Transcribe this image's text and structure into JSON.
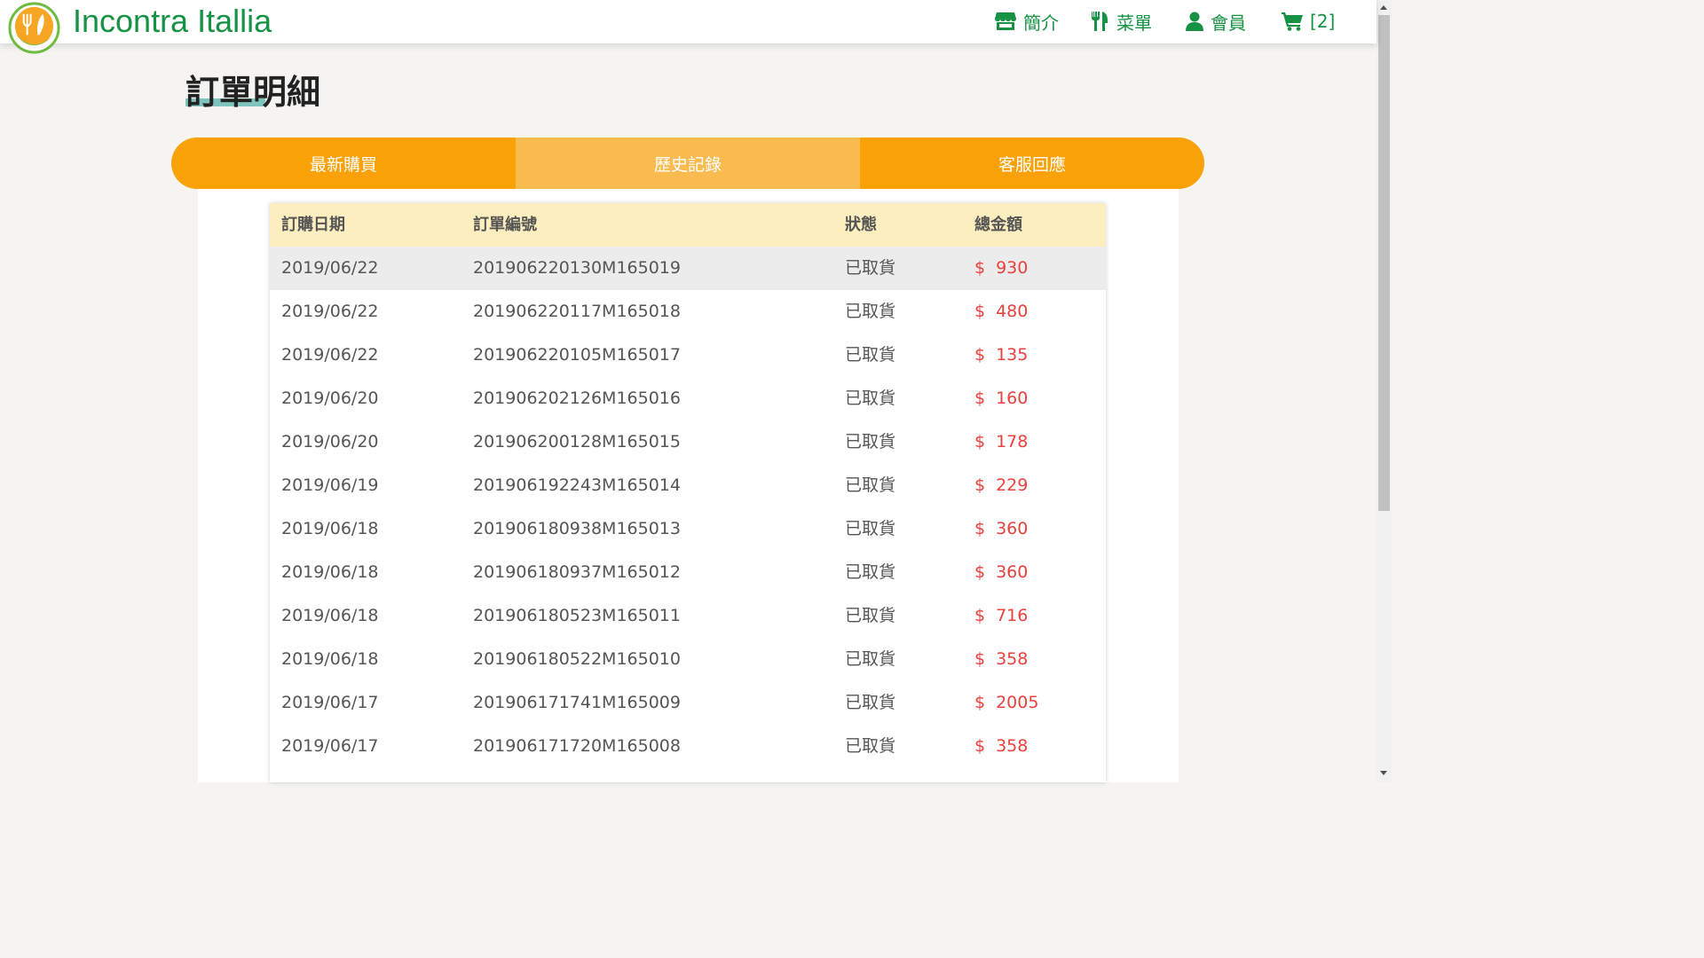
{
  "nav": {
    "brand": "Incontra Itallia",
    "about": "簡介",
    "menu": "菜單",
    "member": "會員",
    "cart": "[2]",
    "icons": [
      "store-icon",
      "utensils-icon",
      "user-icon",
      "cart-icon"
    ],
    "accent_color": "#169245"
  },
  "page": {
    "title": "訂單明細"
  },
  "tabs": [
    {
      "label": "最新購買",
      "active": false
    },
    {
      "label": "歷史記錄",
      "active": true
    },
    {
      "label": "客服回應",
      "active": false
    }
  ],
  "table": {
    "headers": {
      "date": "訂購日期",
      "order_id": "訂單編號",
      "status": "狀態",
      "total": "總金額"
    },
    "currency": "$",
    "rows": [
      {
        "date": "2019/06/22",
        "order_id": "201906220130M165019",
        "status": "已取貨",
        "total": "930"
      },
      {
        "date": "2019/06/22",
        "order_id": "201906220117M165018",
        "status": "已取貨",
        "total": "480"
      },
      {
        "date": "2019/06/22",
        "order_id": "201906220105M165017",
        "status": "已取貨",
        "total": "135"
      },
      {
        "date": "2019/06/20",
        "order_id": "201906202126M165016",
        "status": "已取貨",
        "total": "160"
      },
      {
        "date": "2019/06/20",
        "order_id": "201906200128M165015",
        "status": "已取貨",
        "total": "178"
      },
      {
        "date": "2019/06/19",
        "order_id": "201906192243M165014",
        "status": "已取貨",
        "total": "229"
      },
      {
        "date": "2019/06/18",
        "order_id": "201906180938M165013",
        "status": "已取貨",
        "total": "360"
      },
      {
        "date": "2019/06/18",
        "order_id": "201906180937M165012",
        "status": "已取貨",
        "total": "360"
      },
      {
        "date": "2019/06/18",
        "order_id": "201906180523M165011",
        "status": "已取貨",
        "total": "716"
      },
      {
        "date": "2019/06/18",
        "order_id": "201906180522M165010",
        "status": "已取貨",
        "total": "358"
      },
      {
        "date": "2019/06/17",
        "order_id": "201906171741M165009",
        "status": "已取貨",
        "total": "2005"
      },
      {
        "date": "2019/06/17",
        "order_id": "201906171720M165008",
        "status": "已取貨",
        "total": "358"
      }
    ]
  }
}
